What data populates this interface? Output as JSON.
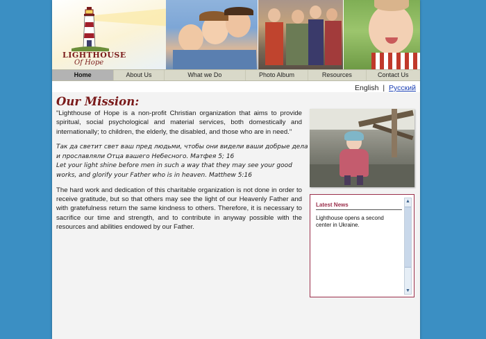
{
  "header": {
    "logo": {
      "name": "LIGHTHOUSE",
      "subtitle": "Of Hope"
    }
  },
  "nav": {
    "items": [
      {
        "label": "Home",
        "active": true
      },
      {
        "label": "About Us"
      },
      {
        "label": "What we Do"
      },
      {
        "label": "Photo Album"
      },
      {
        "label": "Resources"
      },
      {
        "label": "Contact Us"
      }
    ]
  },
  "language": {
    "current": "English",
    "separator": "|",
    "other": "Русский"
  },
  "main": {
    "title": "Our Mission:",
    "intro": "\"Lighthouse of Hope is a non-profit Christian organization that aims to provide spiritual, social psychological and material services, both domestically and internationally; to children, the elderly, the disabled, and those who are in need.\"",
    "scripture": [
      "Так да светит свет ваш пред людьми, чтобы они видели ваши добрые дела",
      "и прославляли Отца вашего Небесного. Матфея 5; 16",
      "Let your light shine before men in such a way that they may see your good",
      "works, and glorify your Father who is in heaven. Matthew 5:16"
    ],
    "body": "The hard work and dedication of this charitable organization is not done in order to receive gratitude, but so that others may see the light of our Heavenly Father and with gratefulness return the same kindness to others. Therefore, it is necessary to sacrifice our time and strength, and to contribute in anyway possible with the resources and abilities endowed by our Father."
  },
  "news": {
    "title": "Latest News",
    "item": "Lighthouse opens a second center in Ukraine."
  },
  "colors": {
    "background": "#3b8fc3",
    "title": "#7a1a1a",
    "news_accent": "#9a2e4a",
    "link": "#1a3fb3"
  }
}
